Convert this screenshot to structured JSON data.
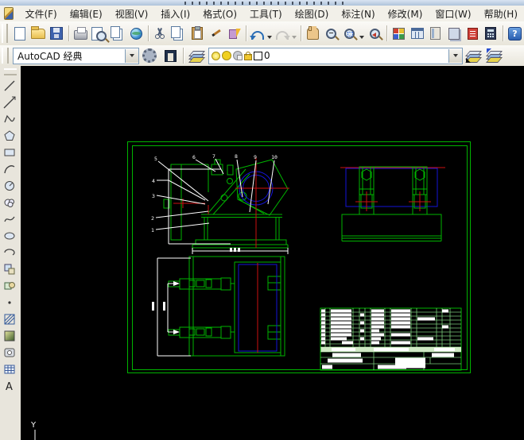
{
  "menubar": {
    "items": [
      {
        "label": "文件(F)"
      },
      {
        "label": "编辑(E)"
      },
      {
        "label": "视图(V)"
      },
      {
        "label": "插入(I)"
      },
      {
        "label": "格式(O)"
      },
      {
        "label": "工具(T)"
      },
      {
        "label": "绘图(D)"
      },
      {
        "label": "标注(N)"
      },
      {
        "label": "修改(M)"
      },
      {
        "label": "窗口(W)"
      },
      {
        "label": "帮助(H)"
      }
    ]
  },
  "toolbar_standard": {
    "buttons": [
      "new",
      "open",
      "save",
      "plot",
      "plot-preview",
      "publish",
      "web",
      "cut",
      "copy",
      "paste",
      "match-properties",
      "block-editor",
      "undo",
      "redo",
      "pan-realtime",
      "zoom-realtime",
      "zoom-window",
      "zoom-previous",
      "properties",
      "designcenter",
      "tool-palettes",
      "sheet-set-manager",
      "markup-set-manager",
      "quickcalc",
      "help"
    ],
    "help_glyph": "?"
  },
  "toolbar_workspace": {
    "workspace_value": "AutoCAD 经典"
  },
  "toolbar_layers": {
    "layer_name": "0"
  },
  "draw_toolbar": {
    "tools": [
      "line",
      "construction-line",
      "polyline",
      "polygon",
      "rectangle",
      "arc",
      "circle",
      "revision-cloud",
      "spline",
      "ellipse",
      "ellipse-arc",
      "insert-block",
      "make-block",
      "point",
      "hatch",
      "gradient",
      "region",
      "table",
      "multiline-text"
    ],
    "mtext_glyph": "A"
  },
  "drawing": {
    "callouts": [
      {
        "label": "1"
      },
      {
        "label": "2"
      },
      {
        "label": "3"
      },
      {
        "label": "4"
      },
      {
        "label": "5"
      },
      {
        "label": "6"
      },
      {
        "label": "7"
      },
      {
        "label": "8"
      },
      {
        "label": "9"
      },
      {
        "label": "10"
      }
    ],
    "ucs_label": "Y",
    "views": [
      "side-elevation-with-callouts",
      "front-view",
      "plan-view",
      "title-block-parts-list"
    ]
  },
  "colors": {
    "canvas": "#000000",
    "frame_green": "#00b400",
    "entity_blue": "#1515d8",
    "centerline_red": "#cc1010",
    "leader_white": "#ffffff",
    "titleblock_highlight": "#cfe9c4"
  }
}
